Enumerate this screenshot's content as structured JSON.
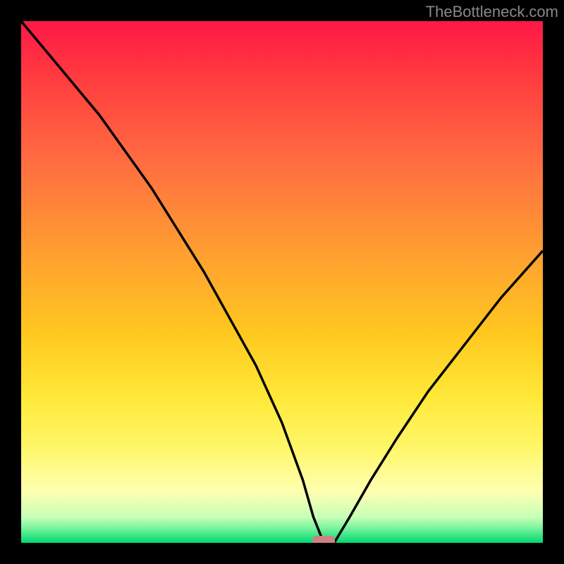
{
  "watermark": "TheBottleneck.com",
  "chart_data": {
    "type": "line",
    "title": "",
    "xlabel": "",
    "ylabel": "",
    "xlim": [
      0,
      100
    ],
    "ylim": [
      0,
      100
    ],
    "background_gradient": {
      "top_color": "#ff1744",
      "mid_colors": [
        "#ff6e40",
        "#ffc107",
        "#ffeb3b",
        "#ffffcc"
      ],
      "bottom_color": "#00e676"
    },
    "marker": {
      "x": 58,
      "y": 0,
      "color": "#d08080",
      "shape": "rounded-rect"
    },
    "series": [
      {
        "name": "bottleneck-curve",
        "x": [
          0,
          5,
          10,
          15,
          20,
          25,
          30,
          35,
          40,
          45,
          50,
          54,
          56,
          58,
          60,
          63,
          67,
          72,
          78,
          85,
          92,
          100
        ],
        "y": [
          100,
          94,
          88,
          82,
          75,
          68,
          60,
          52,
          43,
          34,
          23,
          12,
          5,
          0,
          0,
          5,
          12,
          20,
          29,
          38,
          47,
          56
        ]
      }
    ]
  }
}
